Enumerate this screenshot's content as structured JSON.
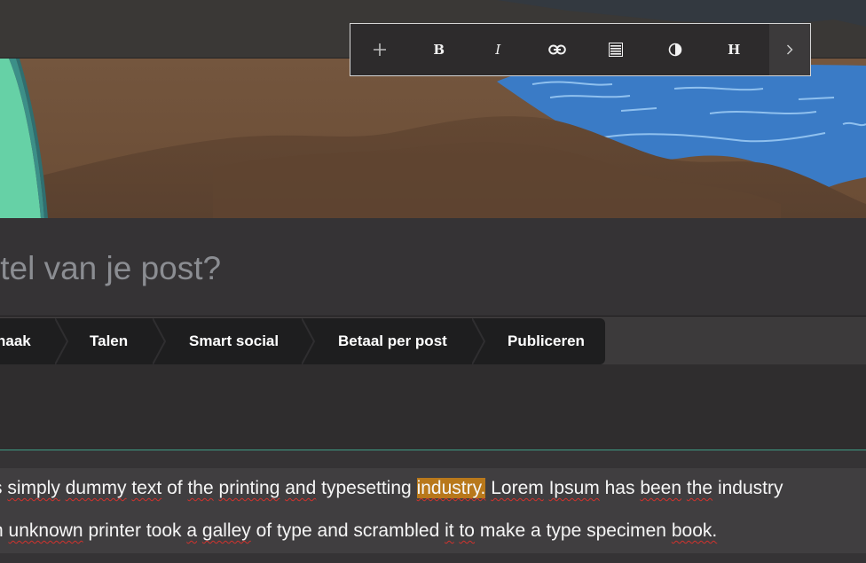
{
  "colors": {
    "background": "#353335",
    "toolbar_bg": "#2d2b2c",
    "tabbar_bg": "#1e1e1f",
    "accent_line": "#3f9d86",
    "highlight": "#b8781b",
    "title_placeholder": "#8b8d92"
  },
  "toolbar": {
    "buttons": [
      {
        "name": "add",
        "icon": "plus-icon"
      },
      {
        "name": "bold",
        "icon": "bold-icon",
        "label": "B"
      },
      {
        "name": "italic",
        "icon": "italic-icon",
        "label": "I"
      },
      {
        "name": "link",
        "icon": "link-icon"
      },
      {
        "name": "align",
        "icon": "align-justify-icon"
      },
      {
        "name": "contrast",
        "icon": "contrast-icon"
      },
      {
        "name": "heading",
        "icon": "heading-icon",
        "label": "H"
      },
      {
        "name": "more",
        "icon": "chevron-right-icon"
      }
    ]
  },
  "title": {
    "placeholder": "itel van je post?"
  },
  "tabs": [
    {
      "label": "naak"
    },
    {
      "label": "Talen"
    },
    {
      "label": "Smart social"
    },
    {
      "label": "Betaal per post"
    },
    {
      "label": "Publiceren"
    }
  ],
  "body": {
    "line1": {
      "w1": "s",
      "w2": "simply",
      "w3": "dummy",
      "w4": "text",
      "w5": "of",
      "w6": "the",
      "w7": "printing",
      "w8": "and",
      "w9": "typesetting",
      "w10": "industry.",
      "w11": "Lorem",
      "w12": "Ipsum",
      "w13": "has",
      "w14": "been",
      "w15": "the",
      "w16": "industry"
    },
    "line2": {
      "w1": "n",
      "w2": "unknown",
      "w3": "printer",
      "w4": "took",
      "w5": "a",
      "w6": "galley",
      "w7": "of",
      "w8": "type",
      "w9": "and",
      "w10": "scrambled",
      "w11": "it",
      "w12": "to",
      "w13": "make",
      "w14": "a",
      "w15": "type",
      "w16": "specimen",
      "w17": "book."
    }
  }
}
